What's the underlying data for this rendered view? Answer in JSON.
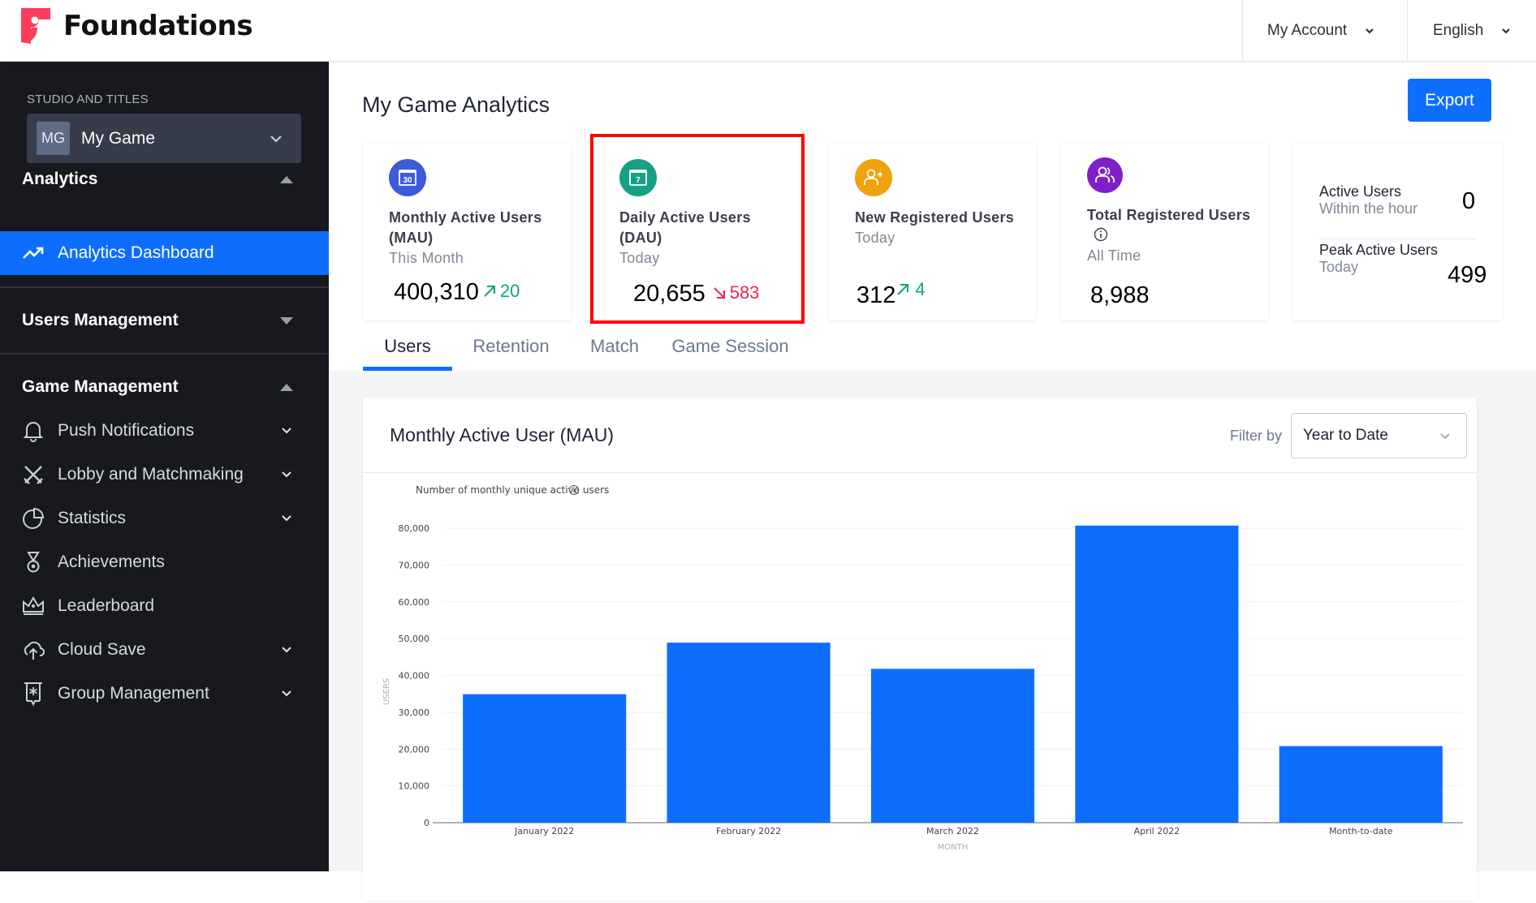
{
  "header": {
    "brand": "Foundations",
    "account_label": "My Account",
    "language_label": "English"
  },
  "sidebar": {
    "studio_label": "STUDIO AND TITLES",
    "studio_badge": "MG",
    "studio_name": "My Game",
    "sections": [
      {
        "label": "Analytics",
        "expanded": true,
        "items": [
          {
            "label": "Analytics Dashboard",
            "icon": "trending-up-icon",
            "active": true
          }
        ]
      },
      {
        "label": "Users Management",
        "expanded": false,
        "items": []
      },
      {
        "label": "Game Management",
        "expanded": true,
        "items": [
          {
            "label": "Push Notifications",
            "icon": "bell-icon",
            "has_children": true
          },
          {
            "label": "Lobby and Matchmaking",
            "icon": "crossed-swords-icon",
            "has_children": true
          },
          {
            "label": "Statistics",
            "icon": "pie-chart-icon",
            "has_children": true
          },
          {
            "label": "Achievements",
            "icon": "medal-icon",
            "has_children": false
          },
          {
            "label": "Leaderboard",
            "icon": "crown-icon",
            "has_children": false
          },
          {
            "label": "Cloud Save",
            "icon": "cloud-upload-icon",
            "has_children": true
          },
          {
            "label": "Group Management",
            "icon": "group-banner-icon",
            "has_children": true
          }
        ]
      }
    ]
  },
  "main": {
    "title": "My Game Analytics",
    "export_label": "Export",
    "cards": [
      {
        "title": "Monthly Active Users (MAU)",
        "period": "This Month",
        "value": "400,310",
        "delta": "20",
        "trend": "up",
        "icon": "calendar-30-icon",
        "icon_text": "30",
        "color": "#3d5bd9"
      },
      {
        "title": "Daily Active Users (DAU)",
        "period": "Today",
        "value": "20,655",
        "delta": "583",
        "trend": "down",
        "icon": "calendar-7-icon",
        "icon_text": "7",
        "color": "#16a085",
        "highlighted": true
      },
      {
        "title": "New Registered Users",
        "period": "Today",
        "value": "312",
        "delta": "4",
        "trend": "up",
        "icon": "user-add-icon",
        "color": "#f0a30a"
      },
      {
        "title": "Total Registered Users",
        "period": "All Time",
        "value": "8,988",
        "icon": "users-icon",
        "color": "#7e1fc9",
        "has_info": true
      }
    ],
    "active_users": {
      "label": "Active Users",
      "sub": "Within the hour",
      "value": "0",
      "peak_label": "Peak Active Users",
      "peak_sub": "Today",
      "peak_value": "499"
    },
    "tabs": [
      {
        "label": "Users",
        "active": true
      },
      {
        "label": "Retention",
        "active": false
      },
      {
        "label": "Match",
        "active": false
      },
      {
        "label": "Game Session",
        "active": false
      }
    ],
    "chart_card": {
      "title": "Monthly Active User (MAU)",
      "filter_label": "Filter by",
      "filter_value": "Year to Date"
    }
  },
  "colors": {
    "accent": "#0d6efd",
    "sidebar_bg": "#17191e",
    "up": "#16a085",
    "down": "#e8264a",
    "highlight": "#ff0000"
  },
  "chart_data": {
    "type": "bar",
    "title": "Number of monthly unique active users",
    "xlabel": "MONTH",
    "ylabel": "USERS",
    "categories": [
      "January 2022",
      "February 2022",
      "March 2022",
      "April 2022",
      "Month-to-date"
    ],
    "values": [
      34900,
      48900,
      41800,
      80700,
      20800
    ],
    "ylim": [
      0,
      80000
    ],
    "yticks": [
      0,
      10000,
      20000,
      30000,
      40000,
      50000,
      60000,
      70000,
      80000
    ],
    "ytick_labels": [
      "0",
      "10,000",
      "20,000",
      "30,000",
      "40,000",
      "50,000",
      "60,000",
      "70,000",
      "80,000"
    ],
    "grid": true,
    "legend": "none",
    "bar_color": "#0d6efd"
  }
}
